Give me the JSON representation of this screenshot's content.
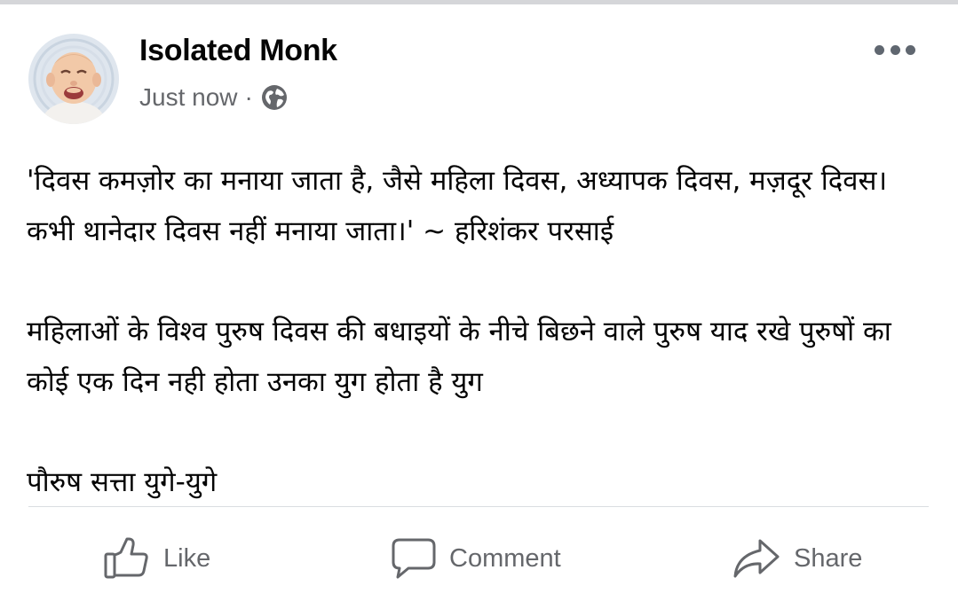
{
  "post": {
    "author": "Isolated Monk",
    "timestamp": "Just now",
    "separator": "·",
    "privacy_icon": "globe-icon",
    "paragraphs": [
      "'दिवस कमज़ोर का मनाया जाता है, जैसे महिला दिवस, अध्यापक दिवस, मज़दूर दिवस। कभी थानेदार दिवस नहीं मनाया जाता।' ~ हरिशंकर परसाई",
      "महिलाओं के विश्व पुरुष दिवस की बधाइयों के नीचे बिछने वाले पुरुष याद रखे पुरुषों का कोई एक दिन नही होता उनका युग होता है युग",
      "पौरुष सत्ता युगे-युगे"
    ]
  },
  "actions": {
    "like_label": "Like",
    "comment_label": "Comment",
    "share_label": "Share"
  },
  "colors": {
    "text_primary": "#050505",
    "text_secondary": "#65676b",
    "divider": "#dadde1"
  }
}
